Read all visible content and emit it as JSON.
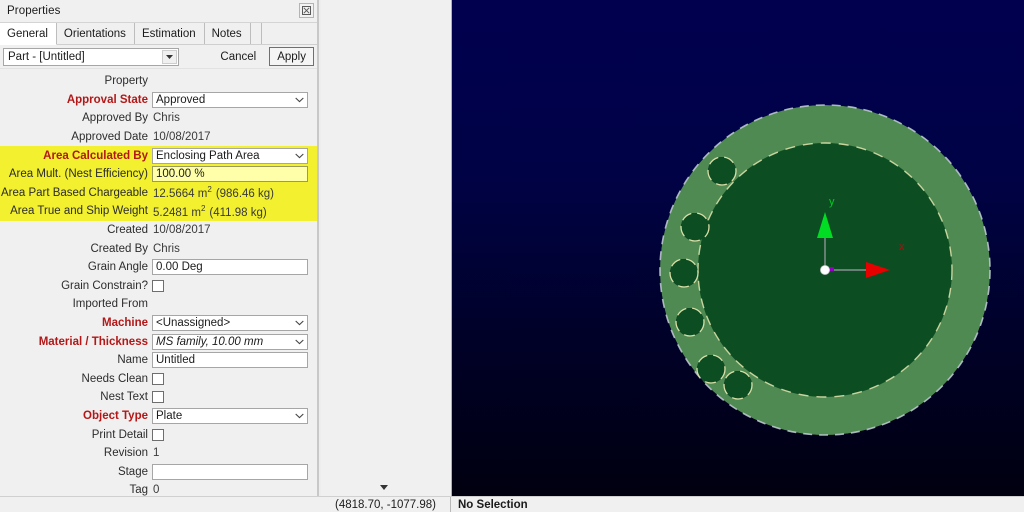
{
  "window": {
    "title": "Properties",
    "close_icon": "close-box-icon"
  },
  "tabs": [
    {
      "label": "General",
      "active": true
    },
    {
      "label": "Orientations",
      "active": false
    },
    {
      "label": "Estimation",
      "active": false
    },
    {
      "label": "Notes",
      "active": false
    }
  ],
  "commandbar": {
    "part_selector_value": "Part - [Untitled]",
    "dropdown_icon": "chevron-down-icon",
    "cancel_label": "Cancel",
    "apply_label": "Apply"
  },
  "grid": {
    "header_label": "Property",
    "header_value": ""
  },
  "properties": [
    {
      "label": "Approval State",
      "kind": "combo",
      "value": "Approved",
      "required": true,
      "highlight": false
    },
    {
      "label": "Approved By",
      "kind": "static",
      "value": "Chris",
      "required": false,
      "highlight": false
    },
    {
      "label": "Approved Date",
      "kind": "static",
      "value": "10/08/2017",
      "required": false,
      "highlight": false
    },
    {
      "label": "Area Calculated By",
      "kind": "combo",
      "value": "Enclosing Path Area",
      "required": true,
      "highlight": true
    },
    {
      "label": "Area Mult. (Nest Efficiency)",
      "kind": "text",
      "value": "100.00 %",
      "required": false,
      "highlight": true
    },
    {
      "label": "Area Part Based Chargeable",
      "kind": "area",
      "value": "12.5664 m",
      "unit_sup": "2",
      "value_tail": "(986.46 kg)",
      "required": false,
      "highlight": true
    },
    {
      "label": "Area True and Ship Weight",
      "kind": "area",
      "value": "5.2481 m",
      "unit_sup": "2",
      "value_tail": "(411.98 kg)",
      "required": false,
      "highlight": true
    },
    {
      "label": "Created",
      "kind": "static",
      "value": "10/08/2017",
      "required": false,
      "highlight": false
    },
    {
      "label": "Created By",
      "kind": "static",
      "value": "Chris",
      "required": false,
      "highlight": false
    },
    {
      "label": "Grain Angle",
      "kind": "text",
      "value": "0.00 Deg",
      "required": false,
      "highlight": false
    },
    {
      "label": "Grain Constrain?",
      "kind": "check",
      "value": "",
      "required": false,
      "highlight": false
    },
    {
      "label": "Imported From",
      "kind": "static",
      "value": "",
      "required": false,
      "highlight": false
    },
    {
      "label": "Machine",
      "kind": "combo",
      "value": "<Unassigned>",
      "required": true,
      "highlight": false
    },
    {
      "label": "Material / Thickness",
      "kind": "combo-i",
      "value": "MS family, 10.00 mm",
      "required": true,
      "highlight": false
    },
    {
      "label": "Name",
      "kind": "text",
      "value": "Untitled",
      "required": false,
      "highlight": false
    },
    {
      "label": "Needs Clean",
      "kind": "check",
      "value": "",
      "required": false,
      "highlight": false
    },
    {
      "label": "Nest Text",
      "kind": "check",
      "value": "",
      "required": false,
      "highlight": false
    },
    {
      "label": "Object Type",
      "kind": "combo",
      "value": "Plate",
      "required": true,
      "highlight": false
    },
    {
      "label": "Print Detail",
      "kind": "check",
      "value": "",
      "required": false,
      "highlight": false
    },
    {
      "label": "Revision",
      "kind": "static",
      "value": "1",
      "required": false,
      "highlight": false
    },
    {
      "label": "Stage",
      "kind": "text",
      "value": "",
      "required": false,
      "highlight": false
    },
    {
      "label": "Tag",
      "kind": "static",
      "value": "0",
      "required": false,
      "highlight": false
    }
  ],
  "viewport": {
    "background_top": "#00004f",
    "background_bottom": "#000010",
    "axis": {
      "x_label": "x",
      "y_label": "y",
      "x_color": "#cc0000",
      "y_color": "#00cc22",
      "origin_color": "#ffffff"
    },
    "part": {
      "outer_ring_color": "#4f8a52",
      "inner_disk_color": "#0d4d22",
      "edge_color": "#d9dfa8",
      "outer_radius_px": 165,
      "inner_radius_px": 127,
      "hole_count": 6,
      "hole_radius_px": 14,
      "hole_ring_radius_px": 146
    }
  },
  "gutter": {
    "caret_icon": "caret-down-icon"
  },
  "statusbar": {
    "coordinates": "(4818.70, -1077.98)",
    "selection": "No Selection"
  }
}
